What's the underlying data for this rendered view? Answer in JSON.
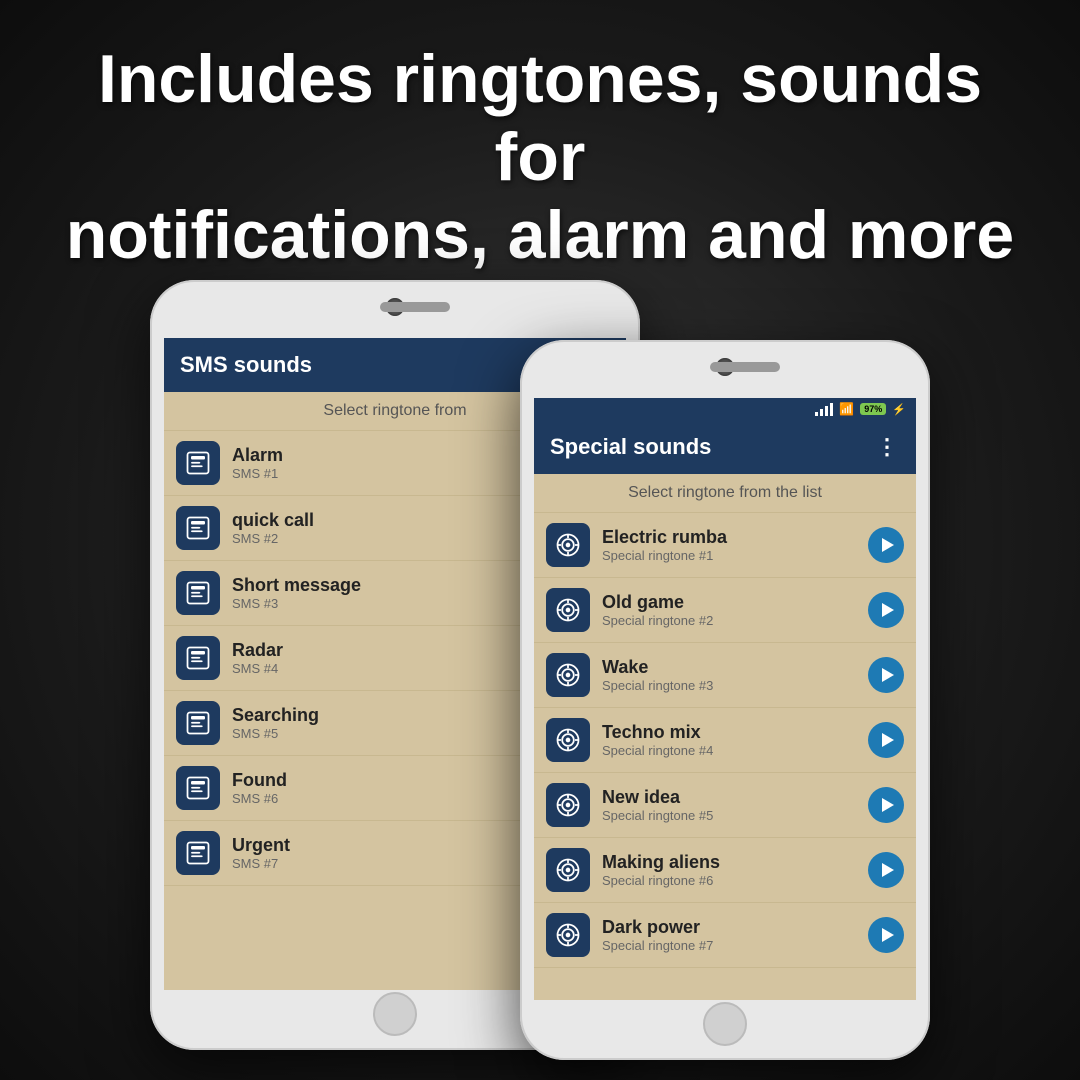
{
  "headline": {
    "line1": "Includes ringtones, sounds for",
    "line2": "notifications, alarm and more"
  },
  "phone_left": {
    "header": "SMS sounds",
    "sub_header": "Select ringtone from",
    "items": [
      {
        "title": "Alarm",
        "subtitle": "SMS #1"
      },
      {
        "title": "quick call",
        "subtitle": "SMS #2"
      },
      {
        "title": "Short message",
        "subtitle": "SMS #3"
      },
      {
        "title": "Radar",
        "subtitle": "SMS #4"
      },
      {
        "title": "Searching",
        "subtitle": "SMS #5"
      },
      {
        "title": "Found",
        "subtitle": "SMS #6"
      },
      {
        "title": "Urgent",
        "subtitle": "SMS #7"
      }
    ]
  },
  "phone_right": {
    "header": "Special sounds",
    "sub_header": "Select ringtone from the list",
    "status": {
      "battery": "97"
    },
    "items": [
      {
        "title": "Electric rumba",
        "subtitle": "Special ringtone #1"
      },
      {
        "title": "Old game",
        "subtitle": "Special ringtone #2"
      },
      {
        "title": "Wake",
        "subtitle": "Special ringtone #3"
      },
      {
        "title": "Techno mix",
        "subtitle": "Special ringtone #4"
      },
      {
        "title": "New idea",
        "subtitle": "Special ringtone #5"
      },
      {
        "title": "Making aliens",
        "subtitle": "Special ringtone #6"
      },
      {
        "title": "Dark power",
        "subtitle": "Special ringtone #7"
      }
    ]
  },
  "icons": {
    "menu_dots": "⋮",
    "sms": "📟",
    "special": "🎯"
  },
  "colors": {
    "header_bg": "#1e3a5f",
    "screen_bg": "#d4c4a0",
    "play_btn": "#1e7ab4",
    "item_icon_bg": "#1e3a5f"
  }
}
